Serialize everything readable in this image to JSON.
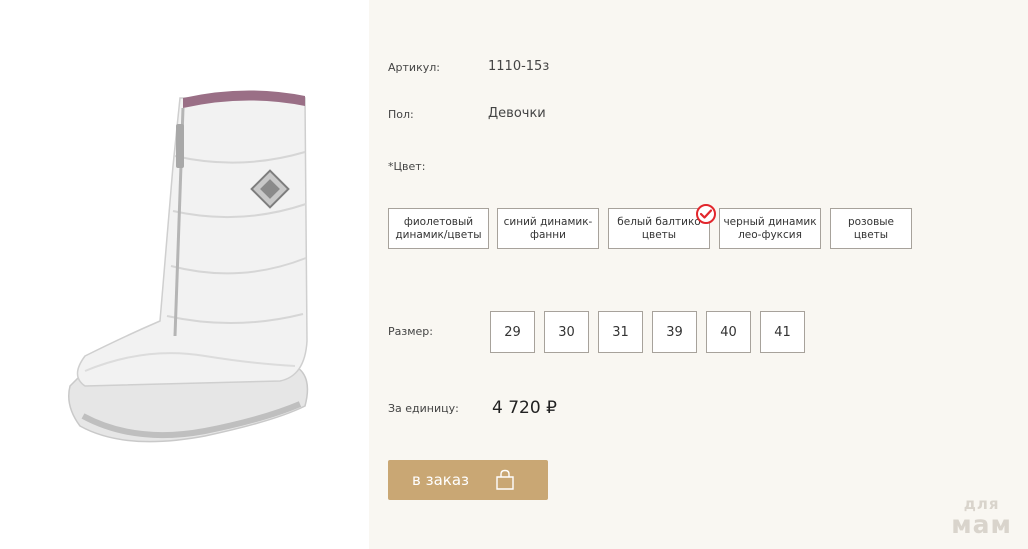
{
  "product": {
    "image_alt": "white winter boot",
    "article_label": "Артикул:",
    "article_value": "1110-15з",
    "gender_label": "Пол:",
    "gender_value": "Девочки",
    "color_label": "*Цвет:",
    "colors": [
      {
        "label": "фиолетовый динамик/цветы",
        "selected": false
      },
      {
        "label": "синий динамик-фанни",
        "selected": false
      },
      {
        "label": "белый балтико цветы",
        "selected": true
      },
      {
        "label": "черный динамик лео-фуксия",
        "selected": false
      },
      {
        "label": "розовые цветы",
        "selected": false
      }
    ],
    "size_label": "Размер:",
    "sizes": [
      "29",
      "30",
      "31",
      "39",
      "40",
      "41"
    ],
    "price_label": "За единицу:",
    "price_value": "4 720 ₽",
    "order_label": "в заказ"
  },
  "watermark": {
    "line1": "для",
    "line2": "мам"
  },
  "colors": {
    "panel_bg": "#f9f7f2",
    "button_bg": "#c9a774",
    "selected_check": "#e2262c",
    "border": "#a7a29b"
  }
}
